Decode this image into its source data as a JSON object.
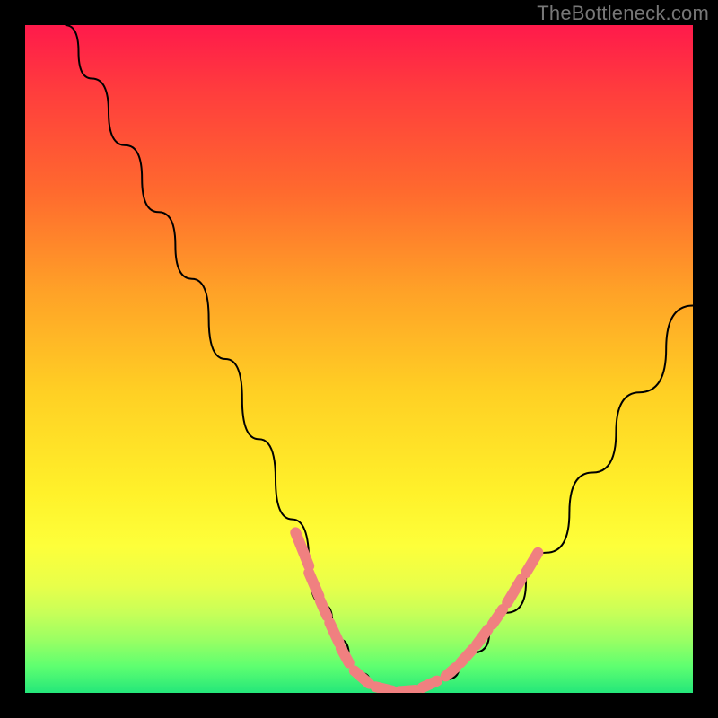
{
  "watermark": "TheBottleneck.com",
  "colors": {
    "background": "#000000",
    "segment": "#f08080",
    "curve": "#000000"
  },
  "chart_data": {
    "type": "line",
    "title": "",
    "xlabel": "",
    "ylabel": "",
    "xlim": [
      0,
      100
    ],
    "ylim": [
      0,
      100
    ],
    "grid": false,
    "series": [
      {
        "name": "curve",
        "x": [
          6,
          10,
          15,
          20,
          25,
          30,
          35,
          40,
          45,
          47,
          50,
          53,
          56,
          58,
          60,
          63,
          67,
          72,
          78,
          85,
          92,
          100
        ],
        "y": [
          100,
          92,
          82,
          72,
          62,
          50,
          38,
          26,
          13,
          8,
          3,
          1,
          0,
          0,
          1,
          2,
          6,
          12,
          21,
          33,
          45,
          58
        ]
      }
    ],
    "highlight_segments": [
      {
        "x1": 40.5,
        "y1": 24,
        "x2": 42.5,
        "y2": 19
      },
      {
        "x1": 42.5,
        "y1": 18,
        "x2": 44,
        "y2": 14.5
      },
      {
        "x1": 44.2,
        "y1": 13.8,
        "x2": 45.2,
        "y2": 11.5
      },
      {
        "x1": 45.6,
        "y1": 10.5,
        "x2": 47,
        "y2": 7.5
      },
      {
        "x1": 47.3,
        "y1": 6.7,
        "x2": 48.5,
        "y2": 4.5
      },
      {
        "x1": 49.3,
        "y1": 3.3,
        "x2": 51.5,
        "y2": 1.4
      },
      {
        "x1": 52.5,
        "y1": 0.9,
        "x2": 55,
        "y2": 0.3
      },
      {
        "x1": 56,
        "y1": 0.2,
        "x2": 58.5,
        "y2": 0.4
      },
      {
        "x1": 59.5,
        "y1": 0.8,
        "x2": 61.7,
        "y2": 1.8
      },
      {
        "x1": 63,
        "y1": 2.5,
        "x2": 64.5,
        "y2": 3.8
      },
      {
        "x1": 65.2,
        "y1": 4.5,
        "x2": 67,
        "y2": 6.5
      },
      {
        "x1": 67.6,
        "y1": 7.2,
        "x2": 69.3,
        "y2": 9.5
      },
      {
        "x1": 70,
        "y1": 10.3,
        "x2": 71.5,
        "y2": 12.5
      },
      {
        "x1": 72.2,
        "y1": 13.5,
        "x2": 74.3,
        "y2": 17
      },
      {
        "x1": 75,
        "y1": 18,
        "x2": 76.8,
        "y2": 21
      }
    ]
  }
}
